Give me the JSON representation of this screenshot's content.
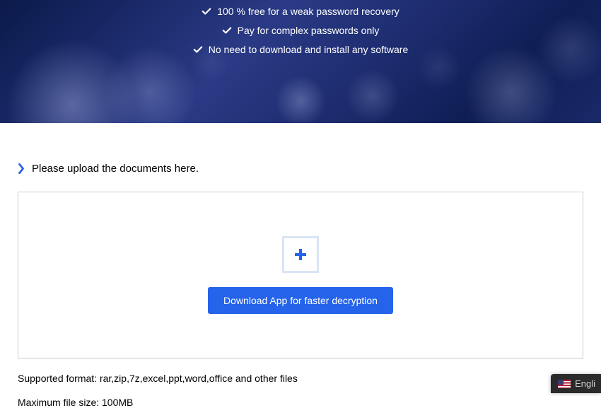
{
  "hero": {
    "features": [
      "100 % free for a weak password recovery",
      "Pay for complex passwords only",
      "No need to download and install any software"
    ]
  },
  "upload": {
    "title": "Please upload the documents here.",
    "button_label": "Download App for faster decryption"
  },
  "info": {
    "supported": "Supported format: rar,zip,7z,excel,ppt,word,office and other files",
    "max_size": "Maximum file size: 100MB"
  },
  "lang": {
    "label": "Engli"
  }
}
